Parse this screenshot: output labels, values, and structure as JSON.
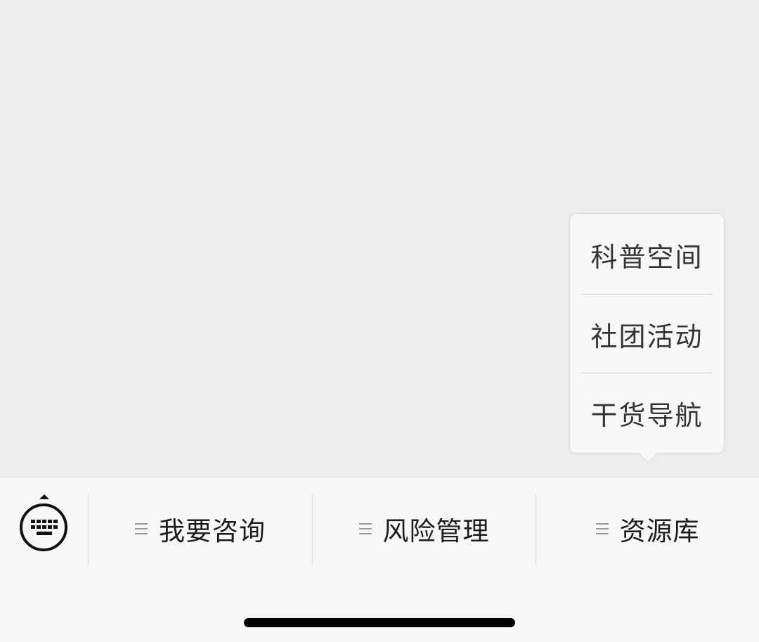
{
  "popup_menu": {
    "items": [
      {
        "label": "科普空间"
      },
      {
        "label": "社团活动"
      },
      {
        "label": "干货导航"
      }
    ]
  },
  "menu_bar": {
    "keyboard_toggle_icon": "keyboard-icon",
    "buttons": [
      {
        "label": "我要咨询",
        "icon": "menu-lines-icon"
      },
      {
        "label": "风险管理",
        "icon": "menu-lines-icon"
      },
      {
        "label": "资源库",
        "icon": "menu-lines-icon"
      }
    ]
  },
  "colors": {
    "background": "#ededed",
    "menu_bar_background": "#f7f7f7",
    "text": "#1c1c1c",
    "icon_gray": "#9a9a9a"
  }
}
